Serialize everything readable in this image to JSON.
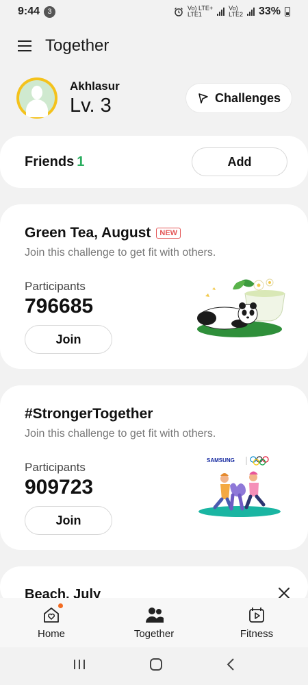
{
  "status": {
    "time": "9:44",
    "notif_count": "3",
    "sim1": "Vo) LTE+",
    "sim1b": "LTE1",
    "sim2": "Vo)",
    "sim2b": "LTE2",
    "battery": "33%"
  },
  "header": {
    "title": "Together"
  },
  "profile": {
    "username": "Akhlasur",
    "level": "Lv. 3",
    "challenges_label": "Challenges"
  },
  "friends": {
    "label": "Friends",
    "count": "1",
    "add_label": "Add"
  },
  "challenges": [
    {
      "title": "Green Tea, August",
      "badge": "NEW",
      "subtitle": "Join this challenge to get fit with others.",
      "participants_label": "Participants",
      "participants": "796685",
      "join_label": "Join"
    },
    {
      "title": "#StrongerTogether",
      "subtitle": "Join this challenge to get fit with others.",
      "participants_label": "Participants",
      "participants": "909723",
      "join_label": "Join",
      "brand": "SAMSUNG"
    }
  ],
  "partial_card": {
    "title": "Beach, July"
  },
  "bottom_nav": [
    {
      "label": "Home",
      "icon": "home-heart-icon"
    },
    {
      "label": "Together",
      "icon": "people-icon"
    },
    {
      "label": "Fitness",
      "icon": "fitness-play-icon"
    }
  ],
  "colors": {
    "accent_green": "#2aad5f",
    "new_badge": "#e35555",
    "notif_dot": "#f26b21"
  }
}
